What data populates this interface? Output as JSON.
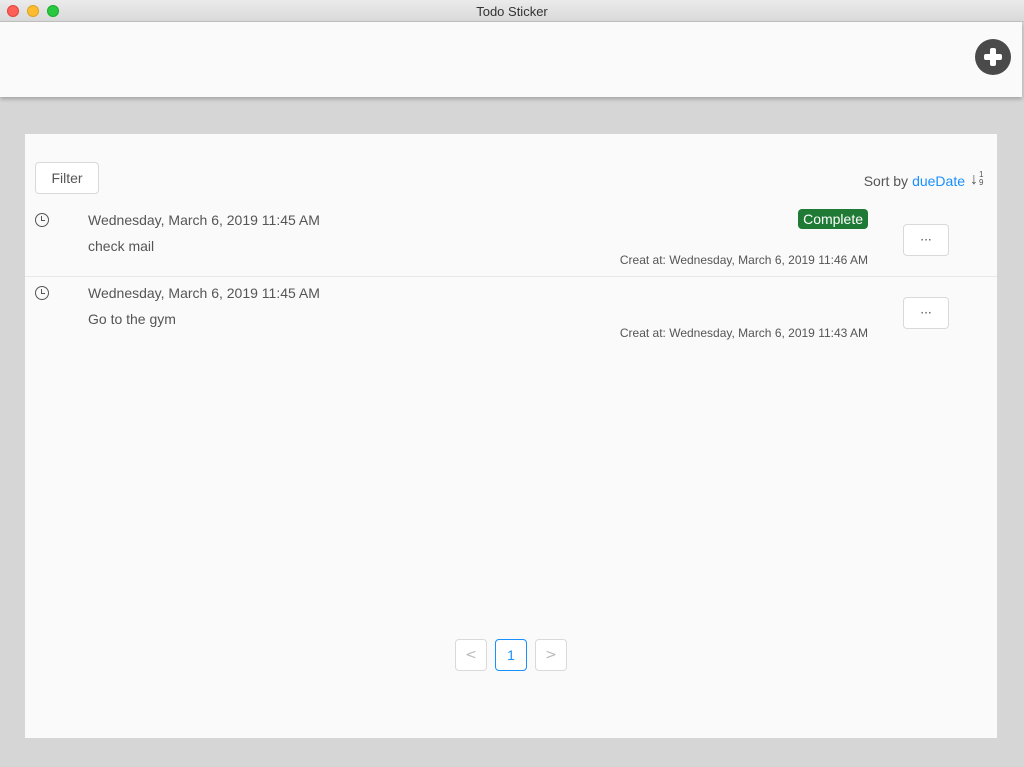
{
  "window": {
    "title": "Todo Sticker"
  },
  "toolbar": {
    "add_icon": "plus-circle-icon"
  },
  "filter": {
    "label": "Filter"
  },
  "sort": {
    "prefix": "Sort by",
    "field": "dueDate",
    "icon": "sort-numeric-down-icon",
    "icon_digits": "1 9"
  },
  "todos": [
    {
      "due": "Wednesday, March 6, 2019 11:45 AM",
      "title": "check mail",
      "status": "Complete",
      "created": "Creat at: Wednesday, March 6, 2019 11:46 AM",
      "menu_label": "···"
    },
    {
      "due": "Wednesday, March 6, 2019 11:45 AM",
      "title": "Go to the gym",
      "status": "",
      "created": "Creat at: Wednesday, March 6, 2019 11:43 AM",
      "menu_label": "···"
    }
  ],
  "pagination": {
    "prev": "<",
    "current": "1",
    "next": ">"
  },
  "colors": {
    "accent": "#1890ff",
    "complete": "#1e7a34"
  }
}
